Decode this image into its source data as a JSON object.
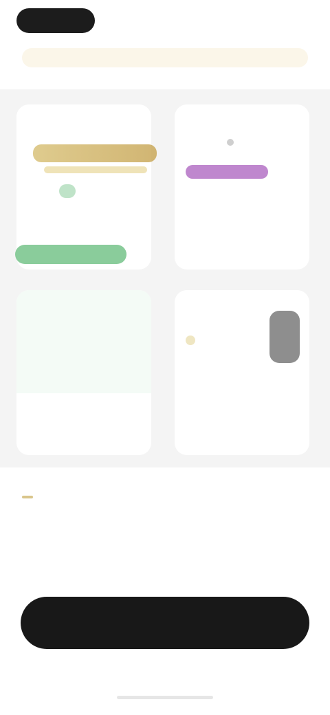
{
  "topbar": {
    "brand": "",
    "link": ""
  },
  "announcement": {
    "text": ""
  },
  "cards": [
    {
      "name": ""
    },
    {
      "name": ""
    },
    {
      "name": ""
    },
    {
      "name": ""
    }
  ],
  "hero": {
    "title": "",
    "highlight": "",
    "subtitle": ""
  },
  "cta": {
    "label": ""
  },
  "colors": {
    "accent_gold": "#d9c58b",
    "purple": "#b87ac9",
    "green": "#7dc790",
    "dark": "#181818"
  }
}
